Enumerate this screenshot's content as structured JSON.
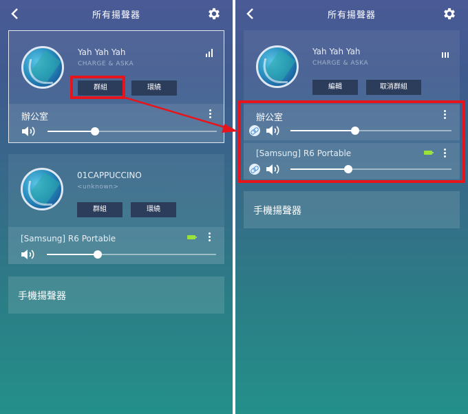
{
  "header": {
    "title": "所有揚聲器"
  },
  "left": {
    "card1": {
      "song": "Yah Yah Yah",
      "artist": "CHARGE & ASKA",
      "btn_group": "群組",
      "btn_surround": "環繞",
      "room": "辦公室",
      "volume": 0.28
    },
    "card2": {
      "song": "01CAPPUCCINO",
      "artist": "<unknown>",
      "btn_group": "群組",
      "btn_surround": "環繞",
      "device": "[Samsung] R6 Portable",
      "volume": 0.3
    },
    "phone_speakers": "手機揚聲器"
  },
  "right": {
    "card1": {
      "song": "Yah Yah Yah",
      "artist": "CHARGE & ASKA",
      "btn_edit": "編輯",
      "btn_ungroup": "取消群組",
      "room": "辦公室",
      "room_volume": 0.4,
      "device": "[Samsung] R6 Portable",
      "device_volume": 0.36
    },
    "phone_speakers": "手機揚聲器"
  },
  "colors": {
    "highlight": "#e8141c",
    "battery": "#9be23a",
    "button": "#2c3d5b"
  }
}
